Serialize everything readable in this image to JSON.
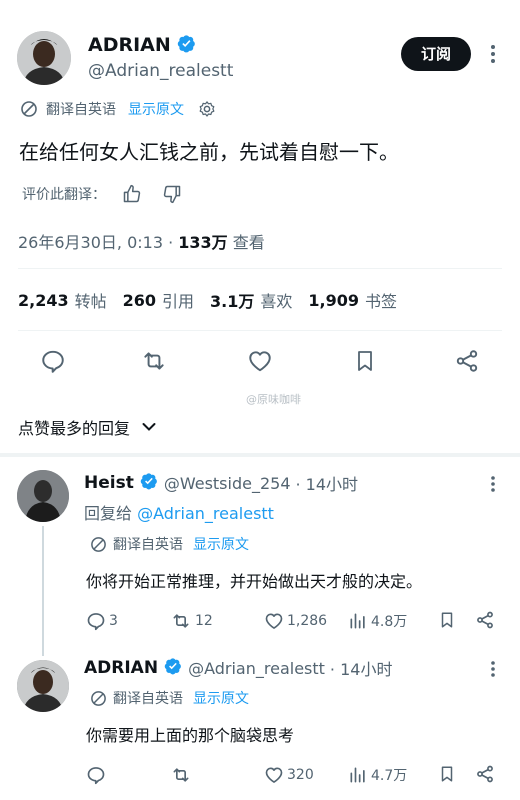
{
  "main_post": {
    "author_name": "ADRIAN",
    "author_handle": "@Adrian_realestt",
    "subscribe_label": "订阅",
    "translate_label": "翻译自英语",
    "show_original_label": "显示原文",
    "content": "在给任何女人汇钱之前，先试着自慰一下。",
    "rate_translation_label": "评价此翻译：",
    "timestamp": "26年6月30日, 0:13 · ",
    "views_count": "133万",
    "views_label": " 查看",
    "stats": {
      "reposts_count": "2,243",
      "reposts_label": "转帖",
      "quotes_count": "260",
      "quotes_label": "引用",
      "likes_count": "3.1万",
      "likes_label": "喜欢",
      "bookmarks_count": "1,909",
      "bookmarks_label": "书签"
    },
    "watermark": "@原味咖啡"
  },
  "replies_header": "点赞最多的回复",
  "replies": [
    {
      "author_name": "Heist",
      "author_handle": "@Westside_254",
      "time": "· 14小时",
      "reply_to_prefix": "回复给",
      "reply_to_handle": "@Adrian_realestt",
      "translate_label": "翻译自英语",
      "show_original_label": "显示原文",
      "content": "你将开始正常推理，并开始做出天才般的决定。",
      "replies_count": "3",
      "reposts_count": "12",
      "likes_count": "1,286",
      "views_count": "4.8万"
    },
    {
      "author_name": "ADRIAN",
      "author_handle": "@Adrian_realestt",
      "time": "· 14小时",
      "translate_label": "翻译自英语",
      "show_original_label": "显示原文",
      "content": "你需要用上面的那个脑袋思考",
      "replies_count": "",
      "reposts_count": "",
      "likes_count": "320",
      "views_count": "4.7万"
    }
  ],
  "colors": {
    "accent": "#1d9bf0",
    "text": "#0f1419",
    "secondary": "#536471"
  }
}
